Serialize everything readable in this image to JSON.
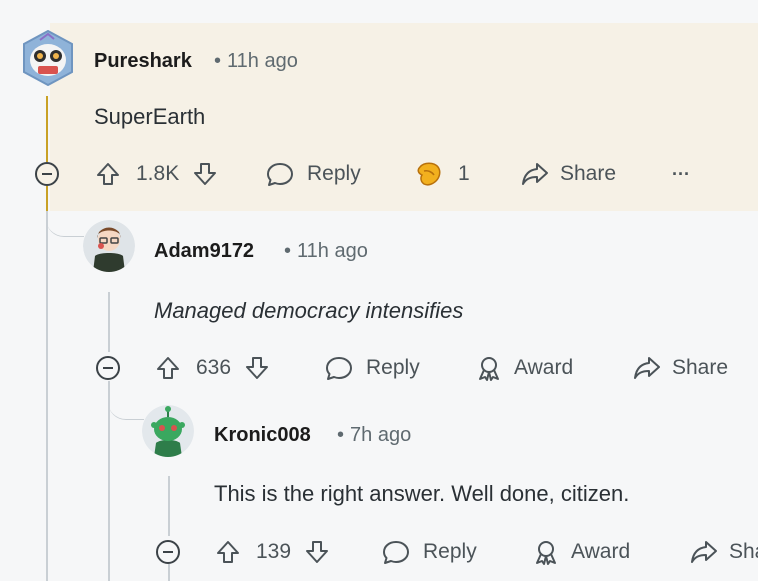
{
  "comments": [
    {
      "username": "Pureshark",
      "time": "11h ago",
      "text": "SuperEarth",
      "votes": "1.8K",
      "reply_label": "Reply",
      "award_count": "1",
      "share_label": "Share",
      "more_label": "···"
    },
    {
      "username": "Adam9172",
      "time": "11h ago",
      "text": "Managed democracy intensifies",
      "votes": "636",
      "reply_label": "Reply",
      "award_label": "Award",
      "share_label": "Share"
    },
    {
      "username": "Kronic008",
      "time": "7h ago",
      "text": "This is the right answer. Well done, citizen.",
      "votes": "139",
      "reply_label": "Reply",
      "award_label": "Award",
      "share_label": "Share"
    }
  ],
  "separator": "•",
  "colors": {
    "highlight_bg": "#f6f1e6",
    "thread_gold": "#c9a227",
    "thread_gray": "#c9cfd4"
  }
}
